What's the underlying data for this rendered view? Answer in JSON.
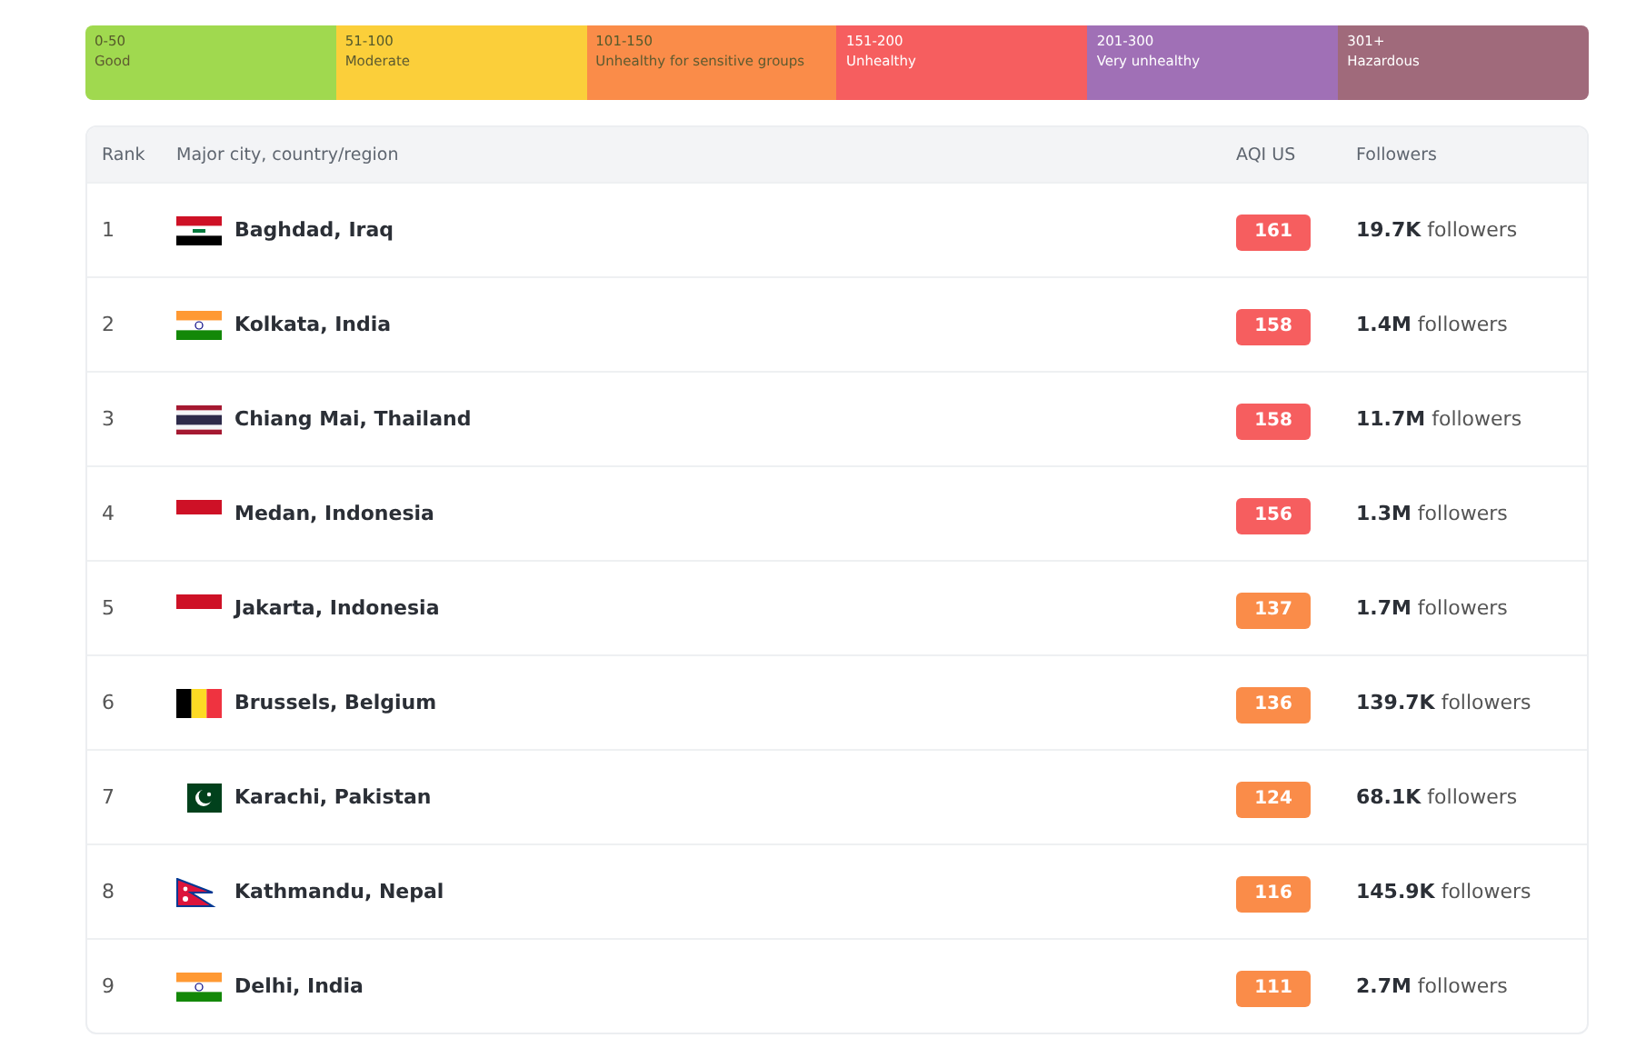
{
  "legend": [
    {
      "range": "0-50",
      "label": "Good",
      "color": "#a0d94f"
    },
    {
      "range": "51-100",
      "label": "Moderate",
      "color": "#fbcf3a"
    },
    {
      "range": "101-150",
      "label": "Unhealthy for sensitive groups",
      "color": "#fa8c49"
    },
    {
      "range": "151-200",
      "label": "Unhealthy",
      "color": "#f65e5f"
    },
    {
      "range": "201-300",
      "label": "Very unhealthy",
      "color": "#a070b6"
    },
    {
      "range": "301+",
      "label": "Hazardous",
      "color": "#a06a7b"
    }
  ],
  "table": {
    "columns": [
      "Rank",
      "Major city, country/region",
      "AQI US",
      "Followers"
    ],
    "rows": [
      {
        "rank": "1",
        "kind": "iraq",
        "city": "Baghdad, Iraq",
        "aqi": "161",
        "color": "#f65e5f",
        "followers": "**19.7K** followers"
      },
      {
        "rank": "2",
        "kind": "india",
        "city": "Kolkata, India",
        "aqi": "158",
        "color": "#f65e5f",
        "followers": "**1.4M** followers"
      },
      {
        "rank": "3",
        "kind": "thailand",
        "city": "Chiang Mai, Thailand",
        "aqi": "158",
        "color": "#f65e5f",
        "followers": "**11.7M** followers"
      },
      {
        "rank": "4",
        "kind": "indonesia",
        "city": "Medan, Indonesia",
        "aqi": "156",
        "color": "#f65e5f",
        "followers": "**1.3M** followers"
      },
      {
        "rank": "5",
        "kind": "indonesia",
        "city": "Jakarta, Indonesia",
        "aqi": "137",
        "color": "#fa8c49",
        "followers": "**1.7M** followers"
      },
      {
        "rank": "6",
        "kind": "belgium",
        "city": "Brussels, Belgium",
        "aqi": "136",
        "color": "#fa8c49",
        "followers": "**139.7K** followers"
      },
      {
        "rank": "7",
        "kind": "pakistan",
        "city": "Karachi, Pakistan",
        "aqi": "124",
        "color": "#fa8c49",
        "followers": "**68.1K** followers"
      },
      {
        "rank": "8",
        "kind": "nepal",
        "city": "Kathmandu, Nepal",
        "aqi": "116",
        "color": "#fa8c49",
        "followers": "**145.9K** followers"
      },
      {
        "rank": "9",
        "kind": "india",
        "city": "Delhi, India",
        "aqi": "111",
        "color": "#fa8c49",
        "followers": "**2.7M** followers"
      }
    ]
  }
}
